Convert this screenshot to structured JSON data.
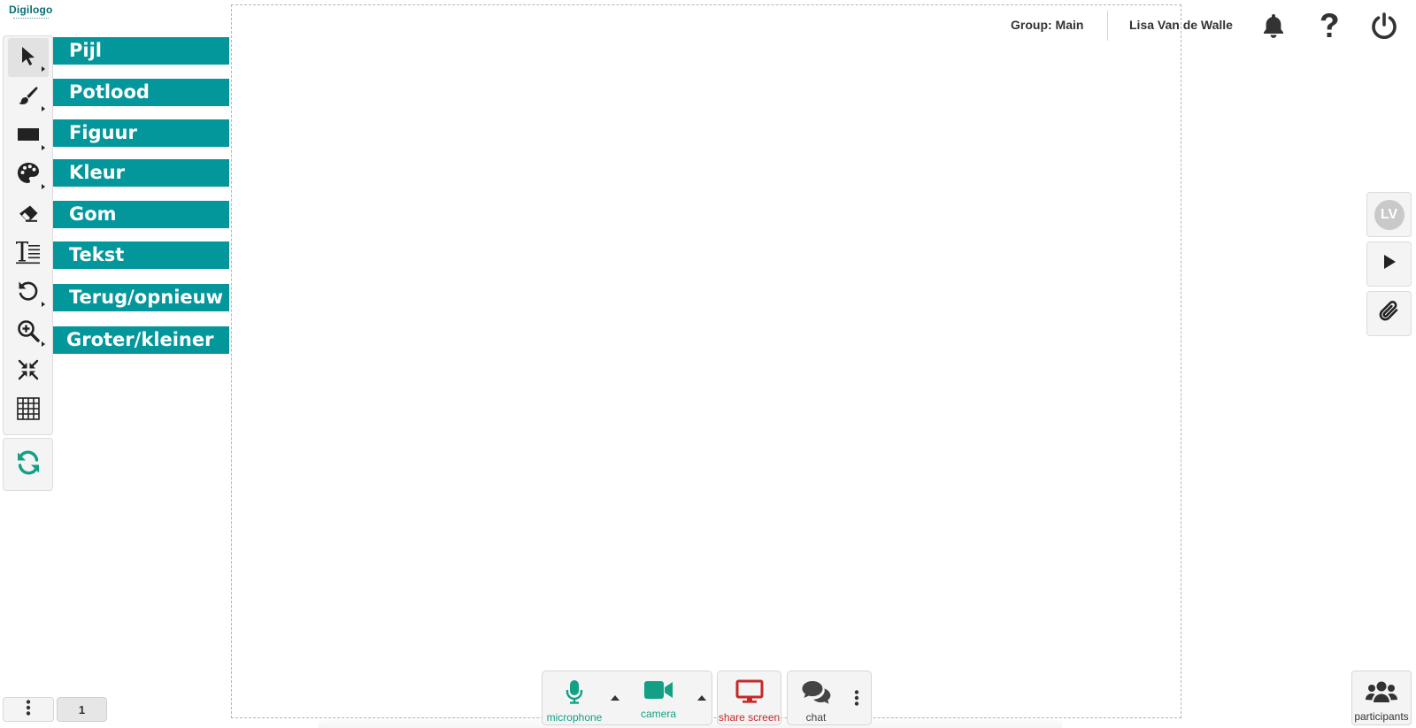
{
  "app": {
    "logo": "Digilogo"
  },
  "header": {
    "group_label": "Group: Main",
    "user_name": "Lisa Van de Walle",
    "icons": [
      "bell-icon",
      "help-icon",
      "power-icon"
    ]
  },
  "toolbar": {
    "tools": [
      {
        "key": "arrow",
        "icon": "arrow-pointer-icon",
        "label": "Pijl",
        "active": true
      },
      {
        "key": "pencil",
        "icon": "brush-icon",
        "label": "Potlood"
      },
      {
        "key": "shape",
        "icon": "rectangle-icon",
        "label": "Figuur"
      },
      {
        "key": "color",
        "icon": "palette-icon",
        "label": "Kleur"
      },
      {
        "key": "eraser",
        "icon": "eraser-icon",
        "label": "Gom"
      },
      {
        "key": "text",
        "icon": "text-icon",
        "label": "Tekst"
      },
      {
        "key": "undo",
        "icon": "undo-icon",
        "label": "Terug/opnieuw"
      },
      {
        "key": "zoom",
        "icon": "zoom-in-icon",
        "label": "Groter/kleiner"
      },
      {
        "key": "compress",
        "icon": "compress-icon"
      },
      {
        "key": "grid",
        "icon": "grid-icon"
      }
    ],
    "refresh_icon": "refresh-icon"
  },
  "right_rail": {
    "avatar_initials": "LV",
    "play_icon": "play-icon",
    "attach_icon": "paperclip-icon"
  },
  "bottom": {
    "page_number": "1",
    "microphone_label": "microphone",
    "camera_label": "camera",
    "share_screen_label": "share screen",
    "chat_label": "chat",
    "participants_label": "participants"
  },
  "colors": {
    "teal": "#03979c",
    "green": "#14a085",
    "red": "#c62828",
    "logo": "#0a6e74"
  }
}
